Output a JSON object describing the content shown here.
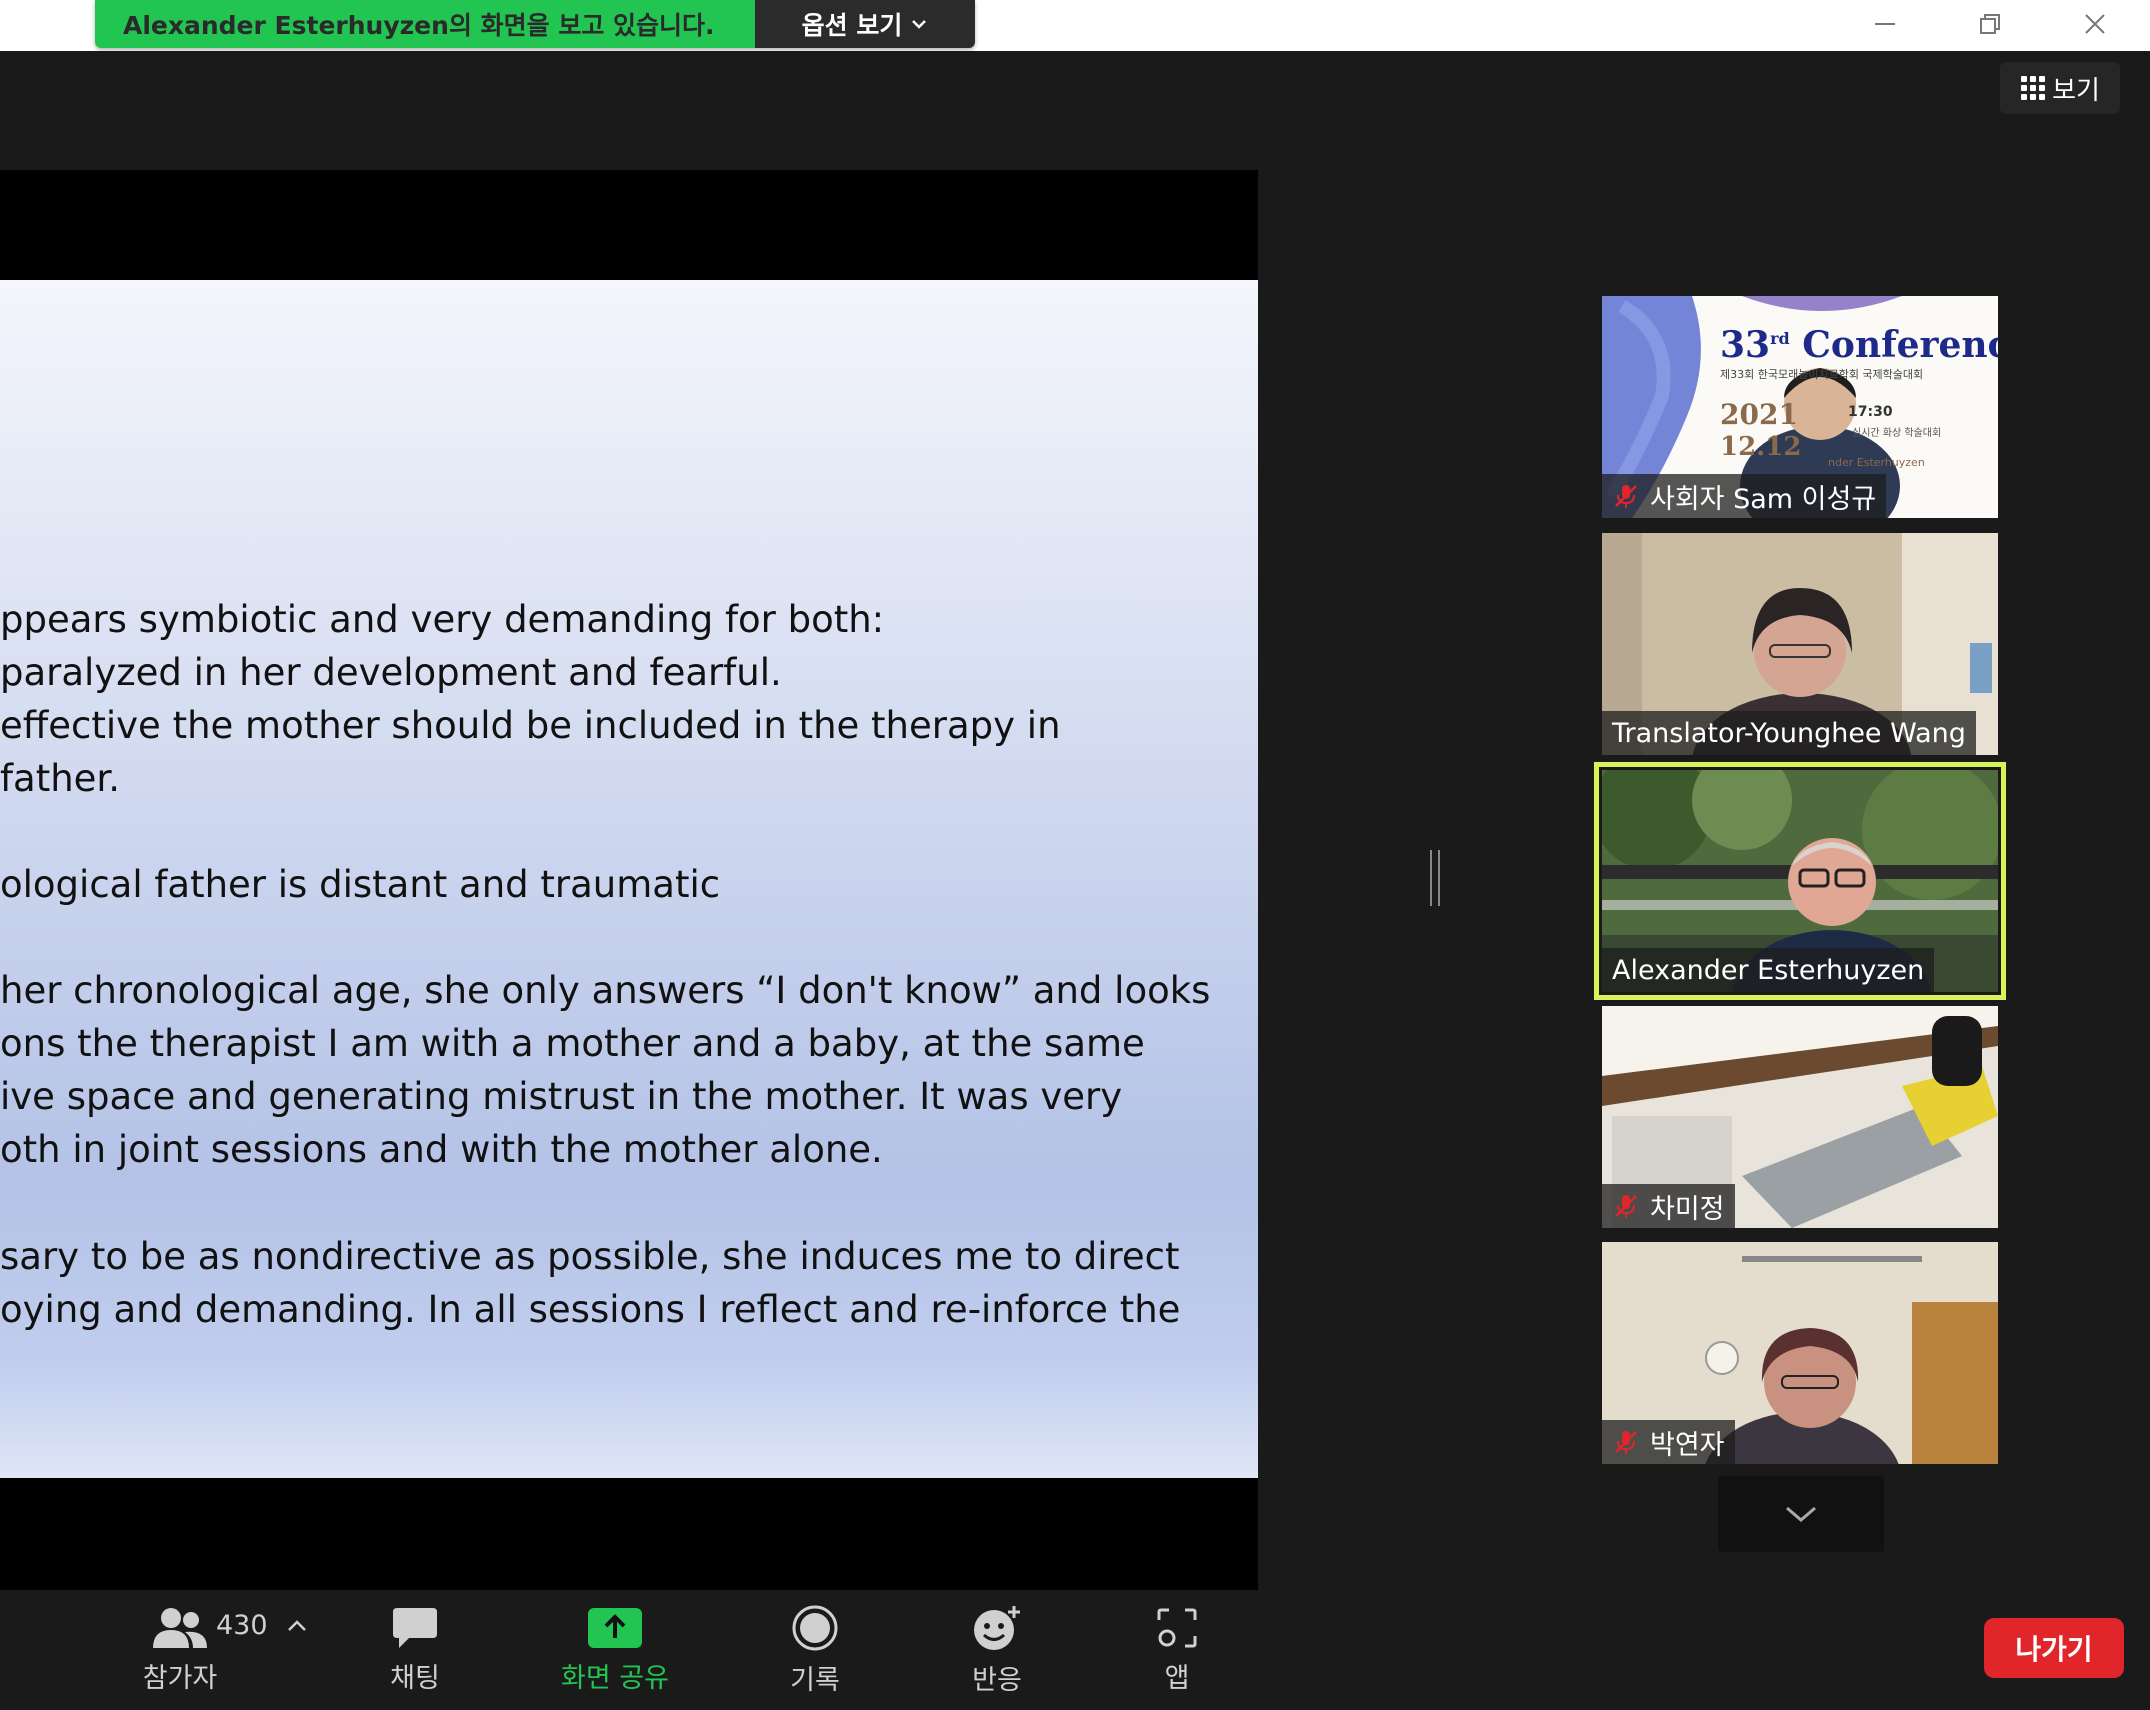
{
  "banner": {
    "sharing_text": "Alexander  Esterhuyzen의 화면을 보고 있습니다.",
    "options_label": "옵션 보기"
  },
  "view_button_label": "보기",
  "slide": {
    "lines": [
      "ppears symbiotic and very demanding for both:",
      " paralyzed in her development and fearful.",
      " effective the mother should be included in the therapy in",
      "father.",
      "ological father is distant and traumatic",
      "her chronological age, she only answers “I don't know” and looks",
      "ons the therapist  I am with a mother and a baby, at the same",
      "ive space and generating mistrust in the mother. It was very",
      "oth in joint sessions and with the mother alone.",
      "sary to be as nondirective as possible, she induces me to direct",
      "oying and demanding. In all sessions I reflect and re-inforce the"
    ]
  },
  "participants": [
    {
      "name": "사회자 Sam 이성규",
      "muted": true,
      "active": false,
      "poster": {
        "title": "33",
        "title_sup": "rd",
        "title_word": "Conference",
        "subtitle": "제33회 한국모래놀이치료학회 국제학술대회",
        "year": "2021",
        "date": "12.12",
        "time": "17:30",
        "session": "실시간 화상 학술대회",
        "speaker": "nder Esterhuyzen"
      }
    },
    {
      "name": "Translator-Younghee Wang",
      "muted": false,
      "active": false
    },
    {
      "name": "Alexander Esterhuyzen",
      "muted": false,
      "active": true
    },
    {
      "name": "차미정",
      "muted": true,
      "active": false
    },
    {
      "name": "박연자",
      "muted": true,
      "active": false
    }
  ],
  "toolbar": {
    "participants_label": "참가자",
    "participants_count": "430",
    "chat_label": "채팅",
    "share_label": "화면 공유",
    "record_label": "기록",
    "reactions_label": "반응",
    "apps_label": "앱",
    "leave_label": "나가기"
  },
  "colors": {
    "share_green": "#23c552",
    "active_speaker": "#d8f25a",
    "leave_red": "#e0262b"
  }
}
